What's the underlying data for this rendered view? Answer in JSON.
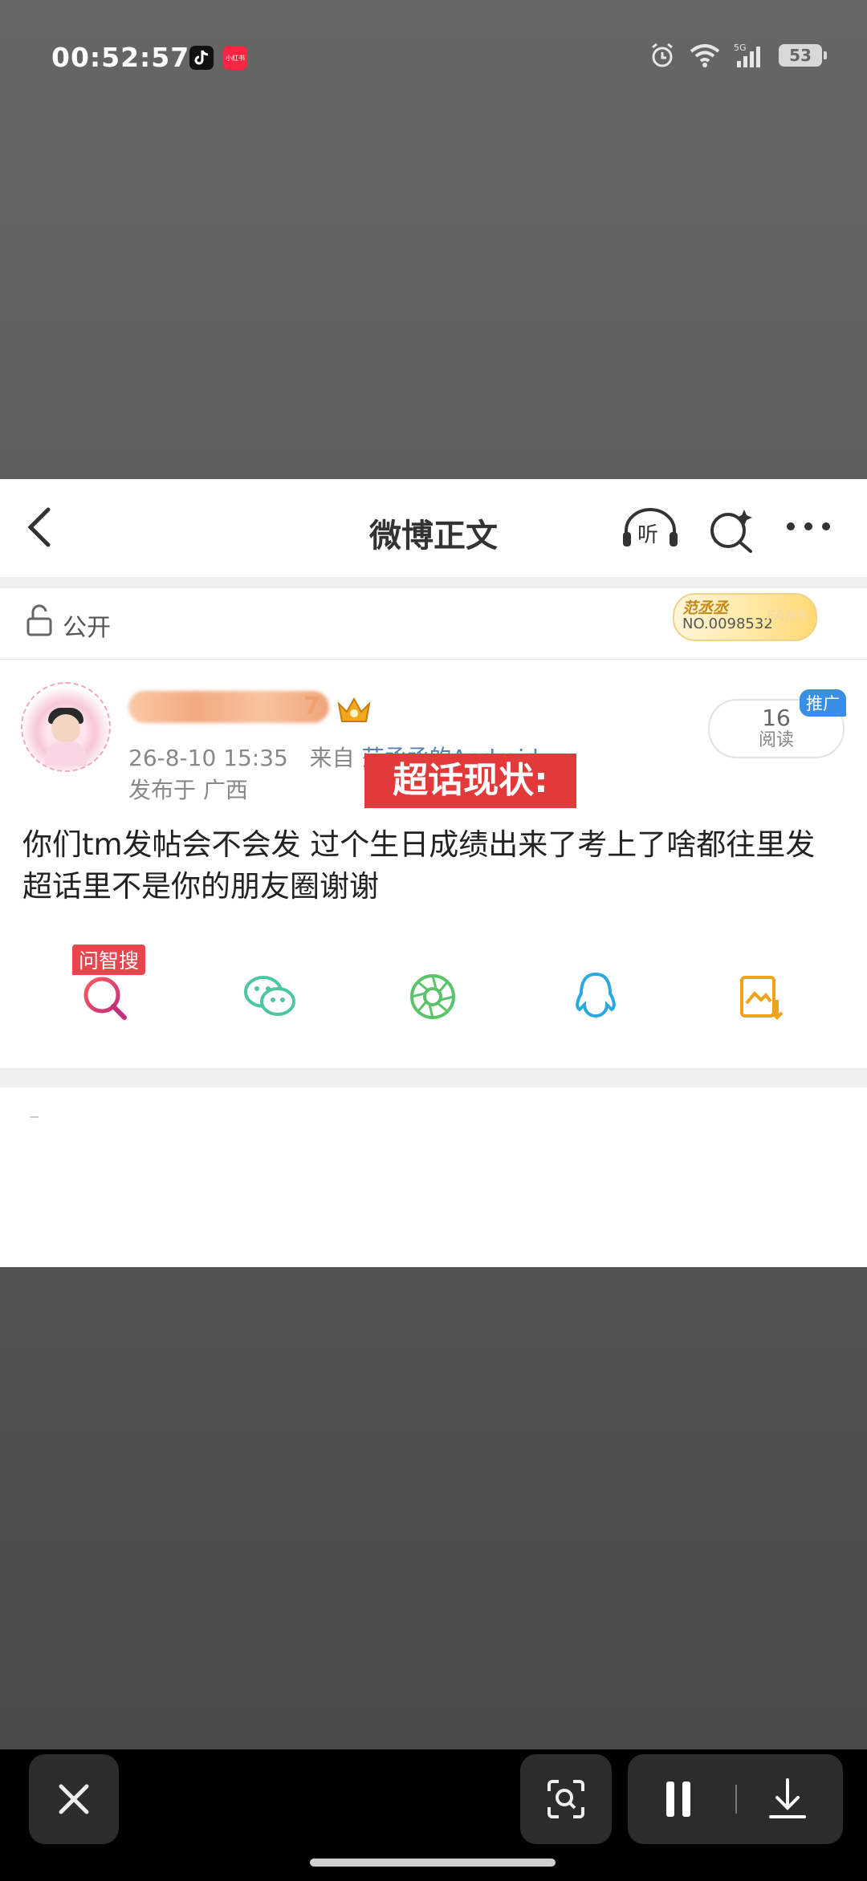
{
  "status_bar": {
    "time": "00:52:57",
    "battery": "53",
    "app_icon_1": "tiktok-icon",
    "app_icon_2": "xiaohongshu-icon",
    "app_icon_2_label": "小红书"
  },
  "header": {
    "title": "微博正文",
    "listen_label": "听"
  },
  "visibility": {
    "label": "公开"
  },
  "fans_badge": {
    "name": "范丞丞",
    "number": "NO.0098532",
    "mark": "FANS"
  },
  "post": {
    "username_tail": "7",
    "timestamp": "26-8-10 15:35",
    "source_prefix": "来自",
    "source": "范丞丞的Android",
    "location": "发布于 广西",
    "read_count": "16",
    "read_label": "阅读",
    "promo_tag": "推广",
    "overlay_label": "超话现状:",
    "text": "你们tm发帖会不会发 过个生日成绩出来了考上了啥都往里发 超话里不是你的朋友圈谢谢"
  },
  "share": {
    "ai_tag": "问智搜",
    "items": [
      "ai-search-icon",
      "wechat-icon",
      "moments-icon",
      "qq-icon",
      "save-image-icon"
    ]
  },
  "colors": {
    "accent_red": "#e5474d",
    "wechat": "#4cc6a1",
    "moments": "#5bc36a",
    "qq": "#2aa8e0",
    "save": "#f0a21b",
    "link": "#5a7fb5"
  }
}
